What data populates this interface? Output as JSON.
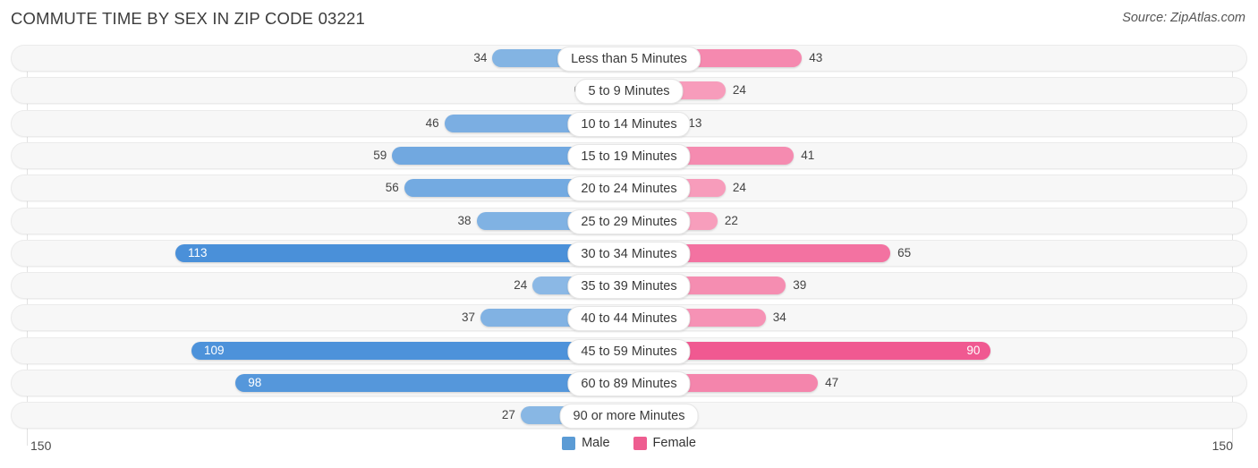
{
  "header": {
    "title": "COMMUTE TIME BY SEX IN ZIP CODE 03221",
    "source": "Source: ZipAtlas.com"
  },
  "axis": {
    "left_label": "150",
    "right_label": "150",
    "max": 150
  },
  "legend": {
    "items": [
      {
        "label": "Male",
        "color": "#5b9bd5"
      },
      {
        "label": "Female",
        "color": "#ee5d90"
      }
    ]
  },
  "colors": {
    "male_strong": "#4a90d9",
    "male_light": "#9cc3e8",
    "female_strong": "#ee4283",
    "female_light": "#f9b4ca",
    "track": "#f7f7f7",
    "track_border": "#ebebeb"
  },
  "chart_data": {
    "type": "bar",
    "title": "COMMUTE TIME BY SEX IN ZIP CODE 03221",
    "subtitle": "Source: ZipAtlas.com",
    "orientation": "horizontal-diverging",
    "xlabel": "",
    "ylabel": "",
    "xlim": [
      -150,
      150
    ],
    "axis_tick_labels": [
      "150",
      "150"
    ],
    "grid": false,
    "legend_position": "bottom-center",
    "categories": [
      "Less than 5 Minutes",
      "5 to 9 Minutes",
      "10 to 14 Minutes",
      "15 to 19 Minutes",
      "20 to 24 Minutes",
      "25 to 29 Minutes",
      "30 to 34 Minutes",
      "35 to 39 Minutes",
      "40 to 44 Minutes",
      "45 to 59 Minutes",
      "60 to 89 Minutes",
      "90 or more Minutes"
    ],
    "series": [
      {
        "name": "Male",
        "values": [
          34,
          0,
          46,
          59,
          56,
          38,
          113,
          24,
          37,
          109,
          98,
          27
        ]
      },
      {
        "name": "Female",
        "values": [
          43,
          24,
          13,
          41,
          24,
          22,
          65,
          39,
          34,
          90,
          47,
          0
        ]
      }
    ]
  },
  "rows": [
    {
      "label": "Less than 5 Minutes",
      "male": "34",
      "female": "43"
    },
    {
      "label": "5 to 9 Minutes",
      "male": "0",
      "female": "24"
    },
    {
      "label": "10 to 14 Minutes",
      "male": "46",
      "female": "13"
    },
    {
      "label": "15 to 19 Minutes",
      "male": "59",
      "female": "41"
    },
    {
      "label": "20 to 24 Minutes",
      "male": "56",
      "female": "24"
    },
    {
      "label": "25 to 29 Minutes",
      "male": "38",
      "female": "22"
    },
    {
      "label": "30 to 34 Minutes",
      "male": "113",
      "female": "65"
    },
    {
      "label": "35 to 39 Minutes",
      "male": "24",
      "female": "39"
    },
    {
      "label": "40 to 44 Minutes",
      "male": "37",
      "female": "34"
    },
    {
      "label": "45 to 59 Minutes",
      "male": "109",
      "female": "90"
    },
    {
      "label": "60 to 89 Minutes",
      "male": "98",
      "female": "47"
    },
    {
      "label": "90 or more Minutes",
      "male": "27",
      "female": "0"
    }
  ]
}
